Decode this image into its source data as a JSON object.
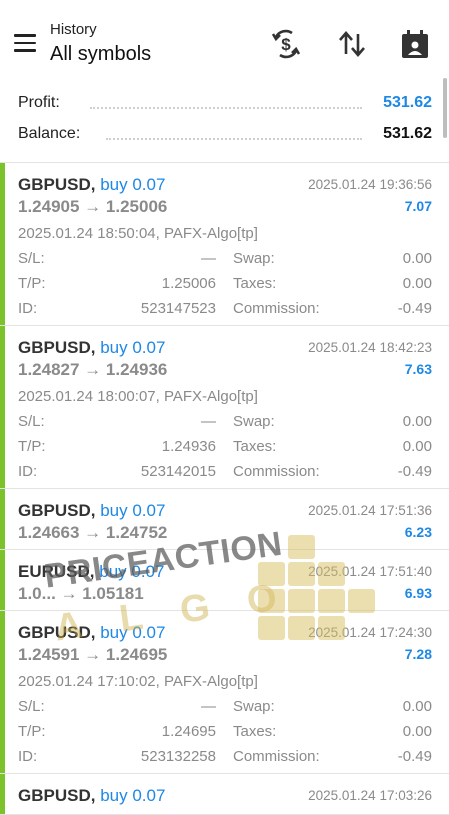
{
  "header": {
    "subtitle": "History",
    "title": "All symbols"
  },
  "summary": {
    "profit_label": "Profit:",
    "profit_value": "531.62",
    "balance_label": "Balance:",
    "balance_value": "531.62",
    "profit_color": "#1e88e5"
  },
  "labels": {
    "sl": "S/L:",
    "tp": "T/P:",
    "id": "ID:",
    "swap": "Swap:",
    "taxes": "Taxes:",
    "commission": "Commission:"
  },
  "deals": [
    {
      "symbol": "GBPUSD,",
      "side": "buy 0.07",
      "time": "2025.01.24 19:36:56",
      "prices": "1.24905 → 1.25006",
      "profit": "7.07",
      "open_info": "2025.01.24 18:50:04, PAFX-Algo[tp]",
      "sl": "—",
      "tp": "1.25006",
      "id": "523147523",
      "swap": "0.00",
      "taxes": "0.00",
      "commission": "-0.49"
    },
    {
      "symbol": "GBPUSD,",
      "side": "buy 0.07",
      "time": "2025.01.24 18:42:23",
      "prices": "1.24827 → 1.24936",
      "profit": "7.63",
      "open_info": "2025.01.24 18:00:07, PAFX-Algo[tp]",
      "sl": "—",
      "tp": "1.24936",
      "id": "523142015",
      "swap": "0.00",
      "taxes": "0.00",
      "commission": "-0.49"
    },
    {
      "symbol": "GBPUSD,",
      "side": "buy 0.07",
      "time": "2025.01.24 17:51:36",
      "prices": "1.24663 → 1.24752",
      "profit": "6.23"
    },
    {
      "symbol": "EURUSD,",
      "side": "buy 0.07",
      "time": "2025.01.24 17:51:40",
      "prices": "1.0... → 1.05181",
      "profit": "6.93"
    },
    {
      "symbol": "GBPUSD,",
      "side": "buy 0.07",
      "time": "2025.01.24 17:24:30",
      "prices": "1.24591 → 1.24695",
      "profit": "7.28",
      "open_info": "2025.01.24 17:10:02, PAFX-Algo[tp]",
      "sl": "—",
      "tp": "1.24695",
      "id": "523132258",
      "swap": "0.00",
      "taxes": "0.00",
      "commission": "-0.49"
    },
    {
      "symbol": "GBPUSD,",
      "side": "buy 0.07",
      "time": "2025.01.24 17:03:26",
      "prices": "",
      "profit": ""
    }
  ],
  "watermark": {
    "line1": "PRICEACTION",
    "line2": "ALGO"
  },
  "colors": {
    "accent": "#1e88e5",
    "buy_bar": "#7cc22a"
  }
}
